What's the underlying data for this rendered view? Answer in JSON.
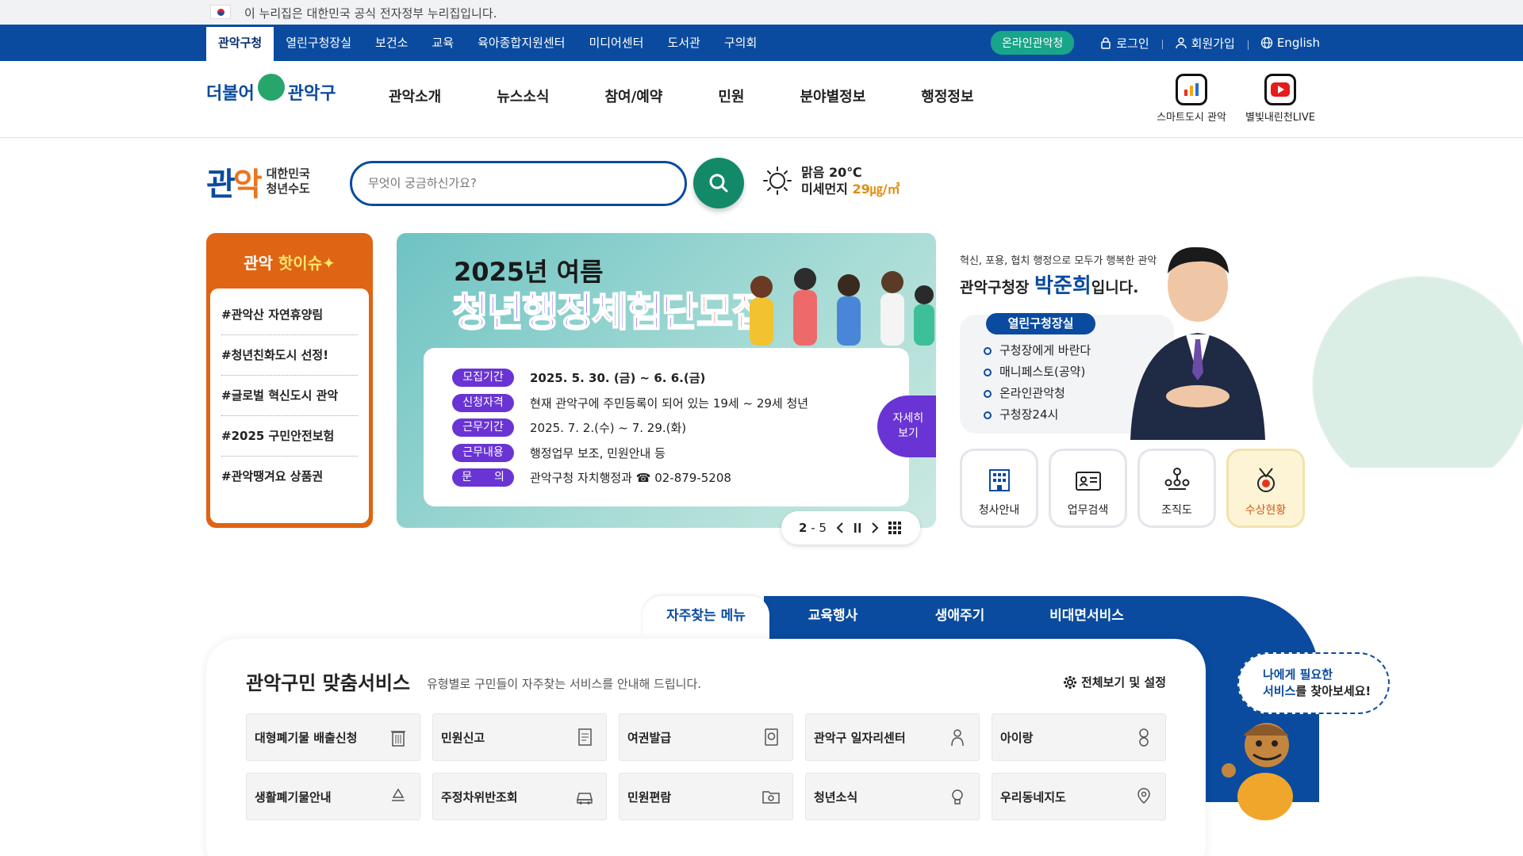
{
  "gov_banner": {
    "text": "이 누리집은 대한민국 공식 전자정부 누리집입니다."
  },
  "util": {
    "tabs": [
      "관악구청",
      "열린구청장실",
      "보건소",
      "교육",
      "육아종합지원센터",
      "미디어센터",
      "도서관",
      "구의회"
    ],
    "online_button": "온라인관악청",
    "login": "로그인",
    "signup": "회원가입",
    "english": "English"
  },
  "header": {
    "logo_left": "더불어",
    "logo_right": "관악구",
    "nav": [
      "관악소개",
      "뉴스소식",
      "참여/예약",
      "민원",
      "분야별정보",
      "행정정보"
    ],
    "smart_city": "스마트도시 관악",
    "live": "별빛내린천LIVE"
  },
  "brand": {
    "big_a": "관",
    "big_b": "악",
    "line1": "대한민국",
    "line2": "청년수도"
  },
  "search": {
    "placeholder": "무엇이 궁금하신가요?"
  },
  "weather": {
    "condition": "맑음 20℃",
    "dust_label": "미세먼지",
    "dust_value": "29㎍/㎥"
  },
  "hot_issue": {
    "title_a": "관악",
    "title_b": "핫이슈",
    "items": [
      "#관악산 자연휴양림",
      "#청년친화도시 선정!",
      "#글로벌 혁신도시 관악",
      "#2025 구민안전보험",
      "#관악땡겨요 상품권"
    ]
  },
  "banner": {
    "year": "2025년 여름",
    "headline_a": "청년행정체험단",
    "headline_b": "모집",
    "rows": [
      {
        "label": "모집기간",
        "value": "2025. 5. 30. (금) ~ 6. 6.(금)"
      },
      {
        "label": "신청자격",
        "value": "현재 관악구에 주민등록이 되어 있는 19세 ~ 29세 청년"
      },
      {
        "label": "근무기간",
        "value": "2025. 7. 2.(수) ~ 7. 29.(화)"
      },
      {
        "label": "근무내용",
        "value": "행정업무 보조, 민원안내 등"
      },
      {
        "label": "문　　의",
        "value": "관악구청 자치행정과 ☎ 02-879-5208"
      }
    ],
    "more_label_1": "자세히",
    "more_label_2": "보기",
    "slide_current": "2",
    "slide_sep": "-",
    "slide_total": "5"
  },
  "mayor": {
    "subtitle": "혁신, 포용, 협치 행정으로 모두가 행복한 관악",
    "title_pre": "관악구청장 ",
    "name": "박준희",
    "title_post": "입니다.",
    "tag": "열린구청장실",
    "links": [
      "구청장에게 바란다",
      "매니페스토(공약)",
      "온라인관악청",
      "구청장24시"
    ]
  },
  "quick_services": [
    "청사안내",
    "업무검색",
    "조직도",
    "수상현황"
  ],
  "service_tabs": [
    "자주찾는 메뉴",
    "교육행사",
    "생애주기",
    "비대면서비스"
  ],
  "service_section": {
    "title": "관악구민 맞춤서비스",
    "desc": "유형별로 구민들이 자주찾는 서비스를 안내해 드립니다.",
    "setting": "전체보기 및 설정",
    "items": [
      "대형폐기물 배출신청",
      "민원신고",
      "여권발급",
      "관악구 일자리센터",
      "아이랑",
      "생활폐기물안내",
      "주정차위반조회",
      "민원편람",
      "청년소식",
      "우리동네지도"
    ]
  },
  "bubble": {
    "line1_a": "나에게 필요한",
    "line2_a": "서비스",
    "line2_b": "를 찾아보세요!"
  },
  "colors": {
    "primary_blue": "#0a4b9f",
    "orange": "#df6413",
    "purple": "#6a34d4",
    "green": "#128a6a"
  }
}
